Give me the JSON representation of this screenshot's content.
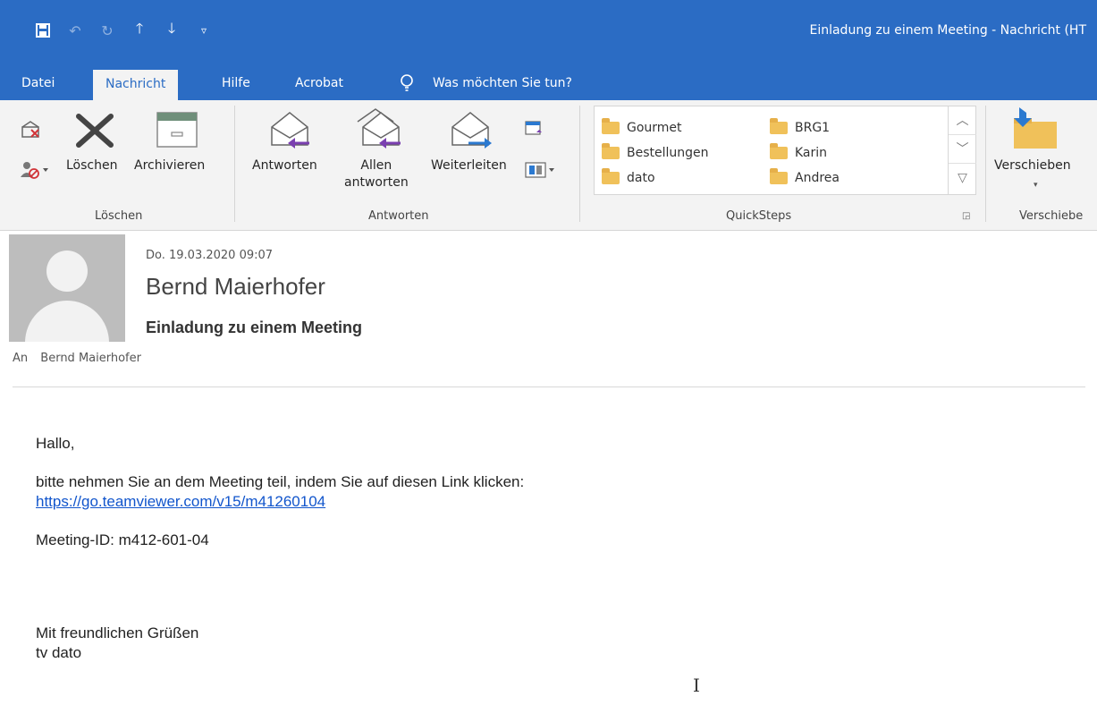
{
  "window": {
    "title": "Einladung zu einem Meeting  -  Nachricht (HT"
  },
  "quick_access": {
    "save_icon": "save-icon",
    "undo_icon": "undo-icon",
    "redo_icon": "redo-icon",
    "up_icon": "arrow-up-icon",
    "down_icon": "arrow-down-icon",
    "customize_icon": "customize-icon"
  },
  "tabs": [
    {
      "label": "Datei"
    },
    {
      "label": "Nachricht"
    },
    {
      "label": "Hilfe"
    },
    {
      "label": "Acrobat"
    },
    {
      "label": "Was möchten Sie tun?"
    }
  ],
  "ribbon": {
    "loeschen": {
      "group_label": "Löschen",
      "delete_label": "Löschen",
      "archive_label": "Archivieren"
    },
    "antworten": {
      "group_label": "Antworten",
      "reply_label": "Antworten",
      "reply_all_line1": "Allen",
      "reply_all_line2": "antworten",
      "forward_label": "Weiterleiten"
    },
    "quicksteps": {
      "group_label": "QuickSteps",
      "items": [
        "Gourmet",
        "Bestellungen",
        "dato",
        "BRG1",
        "Karin",
        "Andrea"
      ]
    },
    "verschieben": {
      "group_label": "Verschiebe",
      "move_label": "Verschieben"
    }
  },
  "message": {
    "date": "Do. 19.03.2020 09:07",
    "sender": "Bernd Maierhofer",
    "subject": "Einladung zu einem Meeting",
    "to_label": "An",
    "to_value": "Bernd Maierhofer"
  },
  "body": {
    "greeting": "Hallo,",
    "line1": "bitte nehmen Sie an dem Meeting teil, indem Sie auf diesen Link klicken:",
    "link": "https://go.teamviewer.com/v15/m41260104",
    "meeting_id": "Meeting-ID: m412-601-04",
    "closing": "Mit freundlichen Grüßen",
    "signature": "tv dato"
  }
}
